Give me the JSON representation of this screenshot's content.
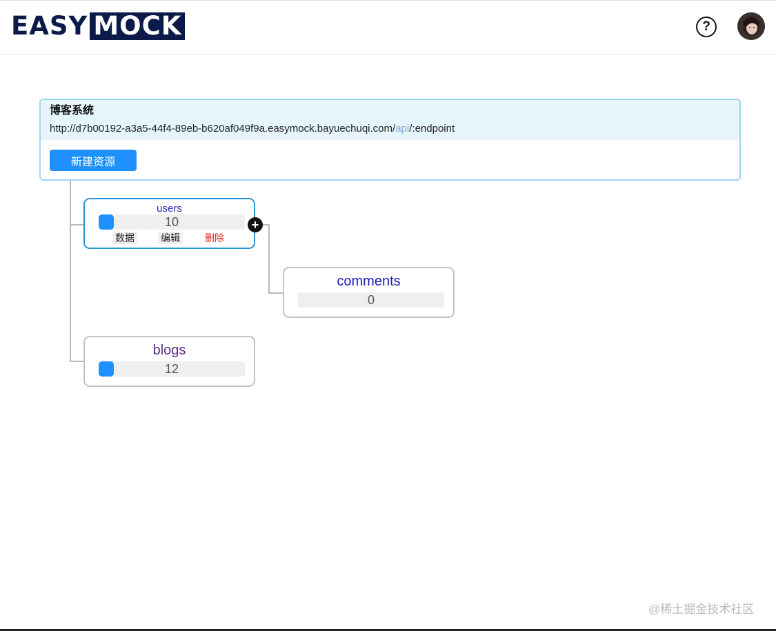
{
  "header": {
    "logo": {
      "part1": "EASY",
      "part2": "MOCK",
      "color": "#0c1a49"
    },
    "help_icon": "help-circle-icon",
    "help_glyph": "?",
    "avatar_icon": "user-avatar-icon"
  },
  "project": {
    "name": "博客系统",
    "base_url": {
      "prefix": "http://d7b00192-a3a5-44f4-89eb-b620af049f9a.easymock.bayuechuqi.com/",
      "api": "api",
      "suffix": "/:endpoint"
    },
    "new_resource_label": "新建资源",
    "accent_color": "#1e90ff"
  },
  "resources": [
    {
      "name": "users",
      "count": "10",
      "name_color": "#2b2bb3",
      "actions": {
        "data": "数据",
        "edit": "编辑",
        "delete": "删除"
      },
      "add_child_glyph": "+",
      "children": [
        {
          "name": "comments",
          "count": "0",
          "name_color": "#1a1ab8"
        }
      ]
    },
    {
      "name": "blogs",
      "count": "12",
      "name_color": "#5e2a82"
    }
  ],
  "watermark": "@稀土掘金技术社区"
}
